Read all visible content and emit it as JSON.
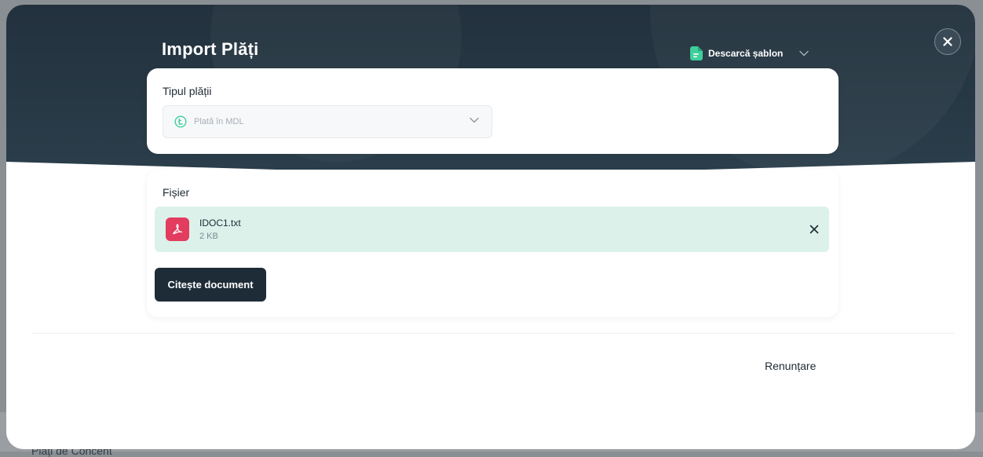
{
  "background": {
    "section_title": "Plăți de Concent"
  },
  "modal": {
    "title": "Import Plăți",
    "download_template_label": "Descarcă șablon",
    "payment_type": {
      "label": "Tipul plății",
      "selected_value": "Plată în MDL",
      "icon": "currency-circle-icon"
    },
    "file_section": {
      "label": "Fișier",
      "file": {
        "name": "IDOC1.txt",
        "size": "2 KB",
        "icon": "pdf-file-icon"
      },
      "read_button_label": "Citește document"
    },
    "cancel_label": "Renunțare"
  },
  "colors": {
    "header_dark": "#22313d",
    "file_row_bg": "#dcf1ea",
    "pdf_icon": "#e23c5f",
    "template_icon": "#3ecf9a",
    "primary_button": "#1e2c38"
  }
}
